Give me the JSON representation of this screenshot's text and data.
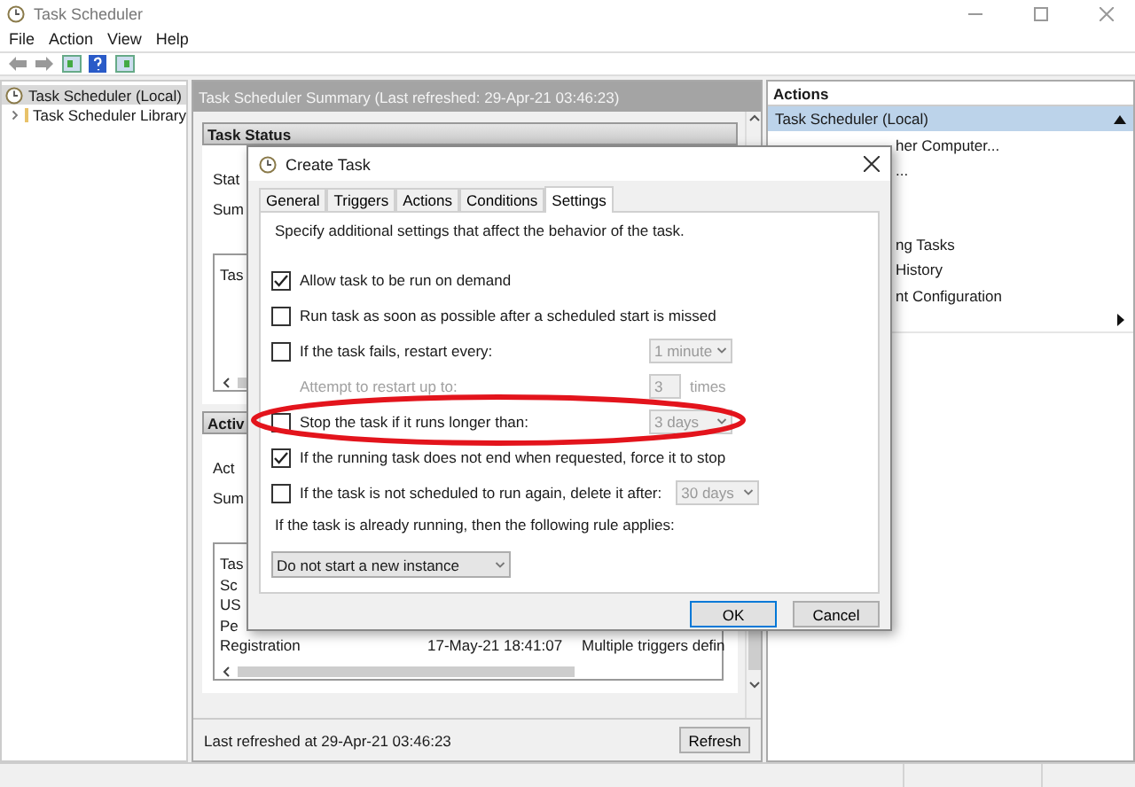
{
  "window": {
    "title": "Task Scheduler"
  },
  "menu": [
    "File",
    "Action",
    "View",
    "Help"
  ],
  "sidebar": {
    "items": [
      {
        "label": "Task Scheduler (Local)",
        "selected": true
      },
      {
        "label": "Task Scheduler Library",
        "selected": false,
        "expanded": false
      }
    ]
  },
  "summary": {
    "header": "Task Scheduler Summary (Last refreshed: 29-Apr-21 03:46:23)",
    "sections": [
      {
        "title": "Task Status",
        "lines": [
          "Stat",
          "Sum"
        ],
        "table_rows": [
          [
            "Tas"
          ]
        ]
      },
      {
        "title": "Activ",
        "lines": [
          "Act",
          "Sum"
        ],
        "table_rows": [
          [
            "Tas"
          ],
          [
            "Sc"
          ],
          [
            "US"
          ],
          [
            "Pe"
          ],
          [
            "Registration",
            "17-May-21 18:41:07",
            "Multiple triggers defin"
          ]
        ]
      }
    ],
    "last_refreshed": "Last refreshed at 29-Apr-21 03:46:23",
    "refresh_button": "Refresh"
  },
  "actions_pane": {
    "title": "Actions",
    "group": "Task Scheduler (Local)",
    "items": [
      {
        "label": "her Computer..."
      },
      {
        "label": "..."
      },
      {
        "label": "ng Tasks"
      },
      {
        "label": "History"
      },
      {
        "label": "nt Configuration"
      },
      {
        "submenu": true
      }
    ]
  },
  "dialog": {
    "title": "Create Task",
    "tabs": [
      {
        "label": "General",
        "selected": false
      },
      {
        "label": "Triggers",
        "selected": false
      },
      {
        "label": "Actions",
        "selected": false
      },
      {
        "label": "Conditions",
        "selected": false
      },
      {
        "label": "Settings",
        "selected": true
      }
    ],
    "description": "Specify additional settings that affect the behavior of the task.",
    "options": [
      {
        "kind": "checkbox",
        "label": "Allow task to be run on demand",
        "checked": true
      },
      {
        "kind": "checkbox",
        "label": "Run task as soon as possible after a scheduled start is missed",
        "checked": false
      },
      {
        "kind": "checkbox",
        "label": "If the task fails, restart every:",
        "checked": false,
        "dropdown": {
          "value": "1 minute",
          "disabled": true
        }
      },
      {
        "kind": "spinner",
        "label": "Attempt to restart up to:",
        "value": "3",
        "unit": "times",
        "disabled": true
      },
      {
        "kind": "checkbox",
        "label": "Stop the task if it runs longer than:",
        "checked": false,
        "dropdown": {
          "value": "3 days",
          "disabled": true
        }
      },
      {
        "kind": "checkbox",
        "label": "If the running task does not end when requested, force it to stop",
        "checked": true
      },
      {
        "kind": "checkbox",
        "label": "If the task is not scheduled to run again, delete it after:",
        "checked": false,
        "dropdown": {
          "value": "30 days",
          "disabled": true
        }
      },
      {
        "kind": "label",
        "label": "If the task is already running, then the following rule applies:"
      },
      {
        "kind": "select",
        "value": "Do not start a new instance",
        "disabled": false
      }
    ],
    "buttons": [
      {
        "label": "OK",
        "default": true
      },
      {
        "label": "Cancel",
        "default": false
      }
    ]
  }
}
